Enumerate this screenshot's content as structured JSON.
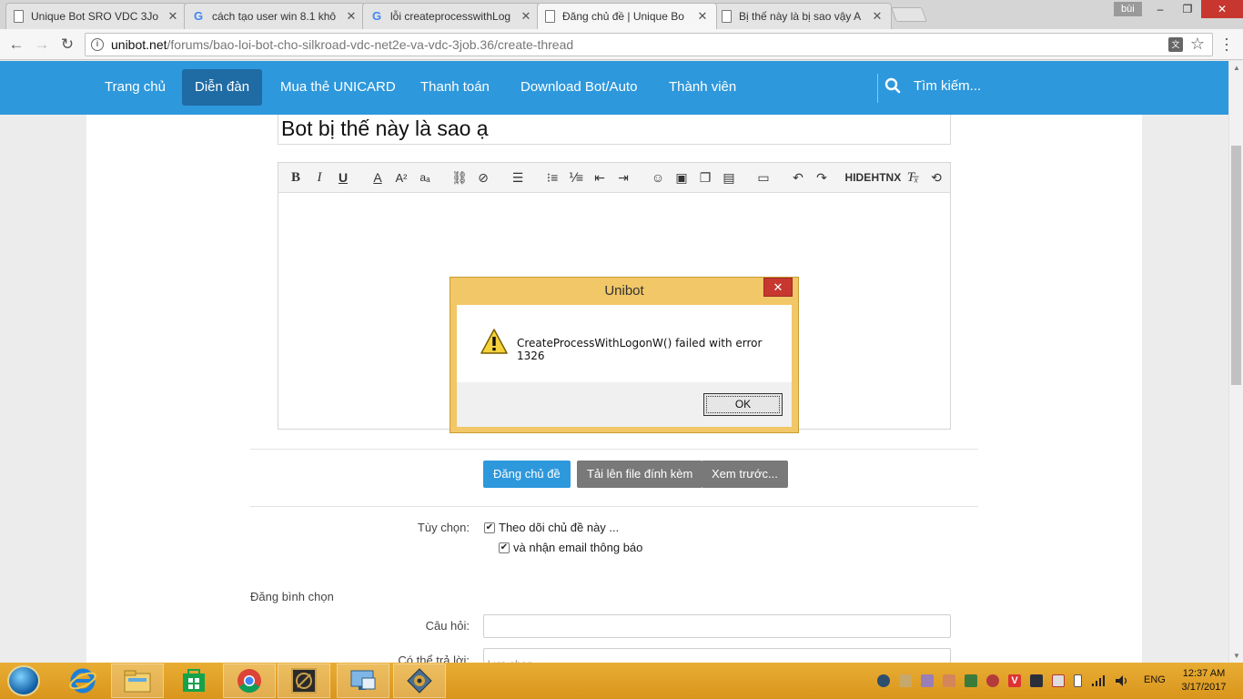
{
  "browser": {
    "tabs": [
      {
        "title": "Unique Bot SRO VDC 3Jo",
        "favicon": "page-icon",
        "active": false
      },
      {
        "title": "cách tạo user win 8.1 khô",
        "favicon": "google-icon",
        "active": false
      },
      {
        "title": "lỗi createprocesswithLog",
        "favicon": "google-icon",
        "active": false
      },
      {
        "title": "Đăng chủ đề | Unique Bo",
        "favicon": "page-icon",
        "active": true
      },
      {
        "title": "Bị thế này là bị sao vậy A",
        "favicon": "page-icon",
        "active": false
      }
    ],
    "close_glyph": "✕",
    "user_badge": "bùi",
    "window_controls": {
      "minimize": "–",
      "restore": "❐",
      "close": "✕"
    },
    "address": {
      "host": "unibot.net",
      "path": "/forums/bao-loi-bot-cho-silkroad-vdc-net2e-va-vdc-3job.36/create-thread"
    },
    "nav_glyphs": {
      "back": "←",
      "forward": "→",
      "reload": "↻",
      "star": "☆",
      "menu": "⋮",
      "info": "i"
    }
  },
  "site_nav": {
    "items": [
      "Trang chủ",
      "Diễn đàn",
      "Mua thẻ UNICARD",
      "Thanh toán",
      "Download Bot/Auto",
      "Thành viên"
    ],
    "active_index": 1,
    "search_label": "Tìm kiếm..."
  },
  "thread": {
    "title": "Bot bị thế này là sao ạ"
  },
  "editor_toolbar": {
    "text_buttons": [
      "HIDE",
      "HTNX"
    ]
  },
  "form": {
    "submit_label": "Đăng chủ đề",
    "upload_label": "Tải lên file đính kèm",
    "preview_label": "Xem trước...",
    "options_label": "Tùy chọn:",
    "watch_label": "Theo dõi chủ đề này ...",
    "email_label": "và nhận email thông báo",
    "poll_heading": "Đăng bình chọn",
    "question_label": "Câu hỏi:",
    "answers_label": "Có thể trả lời:",
    "answers_placeholder": "Lựa chọn..."
  },
  "dialog": {
    "title": "Unibot",
    "message": "CreateProcessWithLogonW() failed with error 1326",
    "ok_label": "OK",
    "close_glyph": "✕",
    "icon": "warning-icon"
  },
  "taskbar": {
    "language": "ENG",
    "time": "12:37 AM",
    "date": "3/17/2017"
  },
  "colors": {
    "site_nav": "#2e98dc",
    "site_nav_active": "#1f6ba4",
    "taskbar": "#e0a22a",
    "dialog_frame": "#f1c767",
    "close_red": "#c7372f"
  }
}
